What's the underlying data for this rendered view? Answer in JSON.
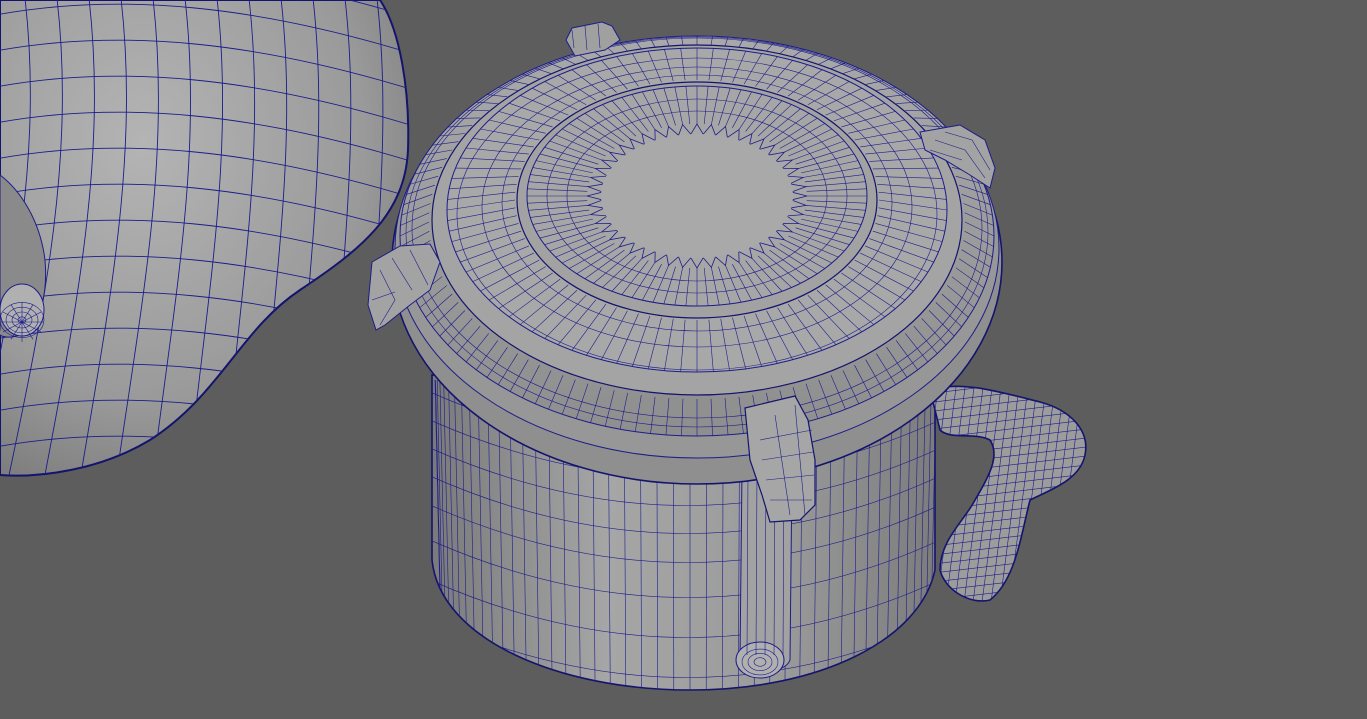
{
  "viewport": {
    "background": "#5d5d5d",
    "wire_color": "#1c1c8a",
    "surface_color": "#9a9a9a",
    "display_mode": "wireframe-on-shaded"
  },
  "scene": {
    "objects": [
      {
        "name": "canister-body-mesh"
      },
      {
        "name": "canister-lid-mesh"
      },
      {
        "name": "canister-handle-mesh"
      },
      {
        "name": "lid-clip-mesh"
      },
      {
        "name": "adjacent-rounded-mesh"
      }
    ]
  }
}
